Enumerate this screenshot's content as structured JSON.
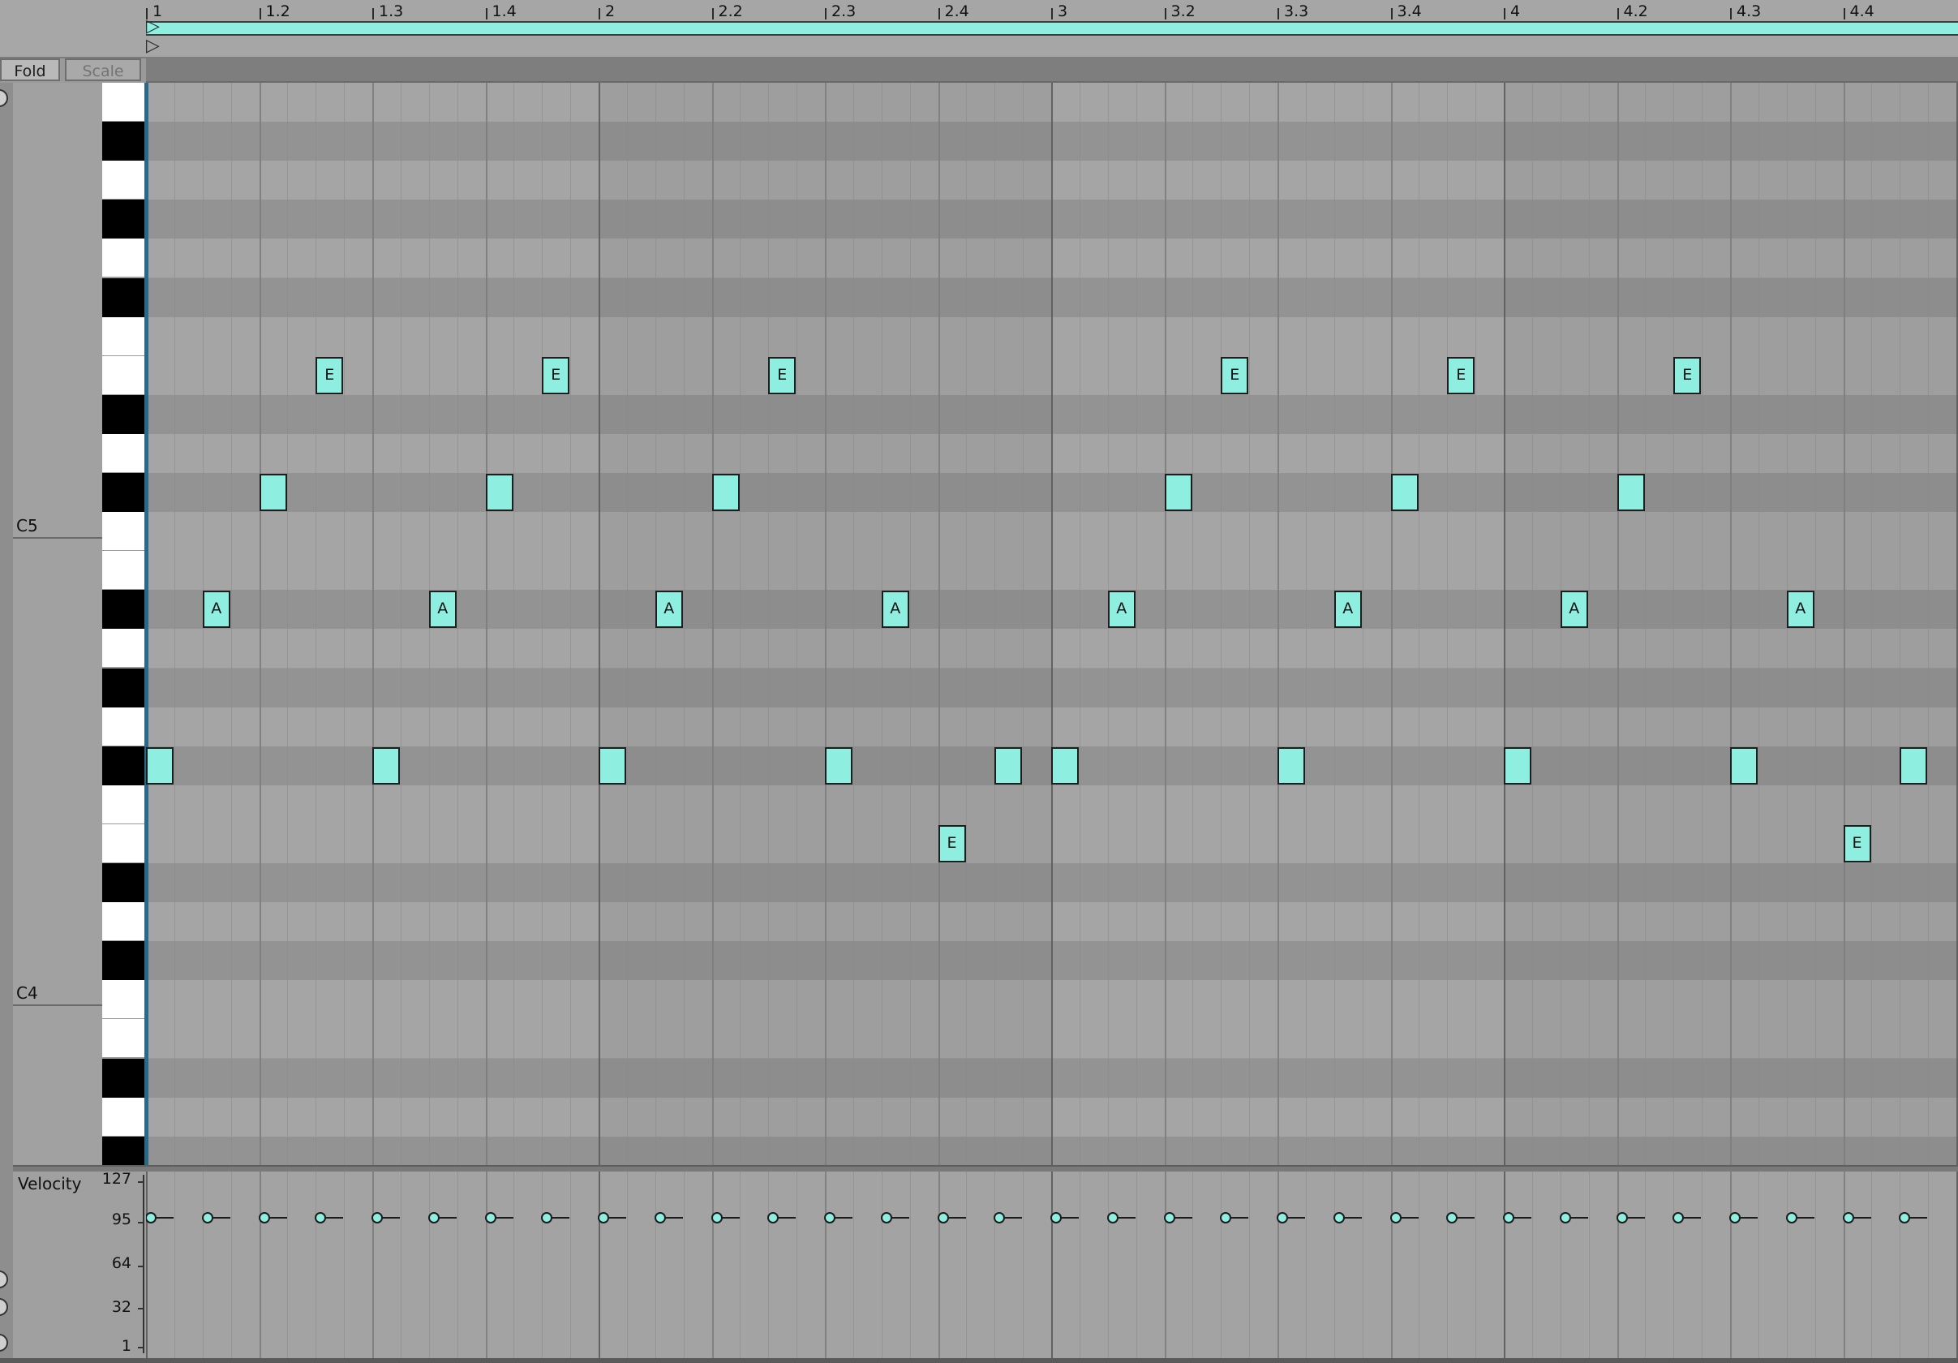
{
  "toolbar": {
    "fold_label": "Fold",
    "scale_label": "Scale"
  },
  "ruler": {
    "labels": [
      "1",
      "1.2",
      "1.3",
      "1.4",
      "2",
      "2.2",
      "2.3",
      "2.4",
      "3",
      "3.2",
      "3.3",
      "3.4",
      "4",
      "4.2",
      "4.3",
      "4.4"
    ]
  },
  "piano": {
    "octave_labels": [
      "C5",
      "C4"
    ]
  },
  "velocity": {
    "title": "Velocity",
    "scale": [
      "127",
      "95",
      "64",
      "32",
      "1"
    ],
    "default_value": 100
  },
  "colors": {
    "note": "#8eefe1",
    "playhead": "#2a6a86",
    "lane_light": "#a5a5a5",
    "lane_dark": "#939393"
  },
  "notes": [
    {
      "beat": 0.0,
      "lane": 17,
      "label": ""
    },
    {
      "beat": 0.5,
      "lane": 13,
      "label": "A"
    },
    {
      "beat": 1.0,
      "lane": 10,
      "label": ""
    },
    {
      "beat": 1.5,
      "lane": 7,
      "label": "E"
    },
    {
      "beat": 2.0,
      "lane": 17,
      "label": ""
    },
    {
      "beat": 2.5,
      "lane": 13,
      "label": "A"
    },
    {
      "beat": 3.0,
      "lane": 10,
      "label": ""
    },
    {
      "beat": 3.5,
      "lane": 7,
      "label": "E"
    },
    {
      "beat": 4.0,
      "lane": 17,
      "label": ""
    },
    {
      "beat": 4.5,
      "lane": 13,
      "label": "A"
    },
    {
      "beat": 5.0,
      "lane": 10,
      "label": ""
    },
    {
      "beat": 5.5,
      "lane": 7,
      "label": "E"
    },
    {
      "beat": 6.0,
      "lane": 17,
      "label": ""
    },
    {
      "beat": 6.5,
      "lane": 13,
      "label": "A"
    },
    {
      "beat": 7.0,
      "lane": 19,
      "label": "E"
    },
    {
      "beat": 7.5,
      "lane": 17,
      "label": ""
    },
    {
      "beat": 8.0,
      "lane": 17,
      "label": ""
    },
    {
      "beat": 8.5,
      "lane": 13,
      "label": "A"
    },
    {
      "beat": 9.0,
      "lane": 10,
      "label": ""
    },
    {
      "beat": 9.5,
      "lane": 7,
      "label": "E"
    },
    {
      "beat": 10.0,
      "lane": 17,
      "label": ""
    },
    {
      "beat": 10.5,
      "lane": 13,
      "label": "A"
    },
    {
      "beat": 11.0,
      "lane": 10,
      "label": ""
    },
    {
      "beat": 11.5,
      "lane": 7,
      "label": "E"
    },
    {
      "beat": 12.0,
      "lane": 17,
      "label": ""
    },
    {
      "beat": 12.5,
      "lane": 13,
      "label": "A"
    },
    {
      "beat": 13.0,
      "lane": 10,
      "label": ""
    },
    {
      "beat": 13.5,
      "lane": 7,
      "label": "E"
    },
    {
      "beat": 14.0,
      "lane": 17,
      "label": ""
    },
    {
      "beat": 14.5,
      "lane": 13,
      "label": "A"
    },
    {
      "beat": 15.0,
      "lane": 19,
      "label": "E"
    },
    {
      "beat": 15.5,
      "lane": 17,
      "label": ""
    }
  ]
}
